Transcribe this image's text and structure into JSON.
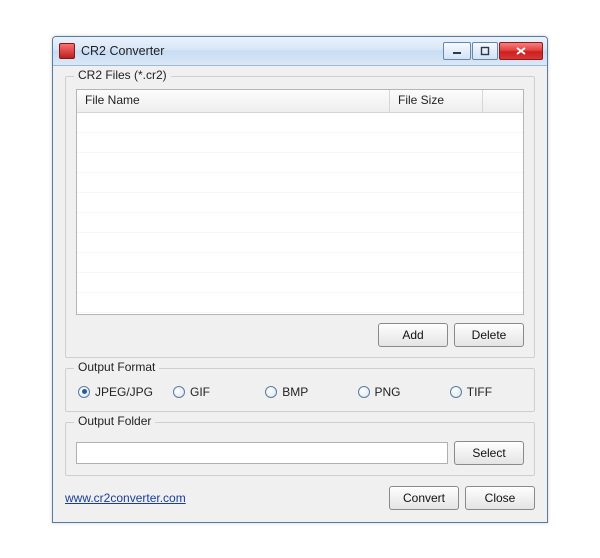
{
  "window": {
    "title": "CR2 Converter"
  },
  "files": {
    "group_label": "CR2 Files (*.cr2)",
    "col_name": "File Name",
    "col_size": "File Size",
    "add_label": "Add",
    "delete_label": "Delete"
  },
  "format": {
    "group_label": "Output Format",
    "options": [
      {
        "label": "JPEG/JPG",
        "selected": true
      },
      {
        "label": "GIF",
        "selected": false
      },
      {
        "label": "BMP",
        "selected": false
      },
      {
        "label": "PNG",
        "selected": false
      },
      {
        "label": "TIFF",
        "selected": false
      }
    ]
  },
  "folder": {
    "group_label": "Output Folder",
    "value": "",
    "select_label": "Select"
  },
  "footer": {
    "link": "www.cr2converter.com",
    "convert_label": "Convert",
    "close_label": "Close"
  }
}
